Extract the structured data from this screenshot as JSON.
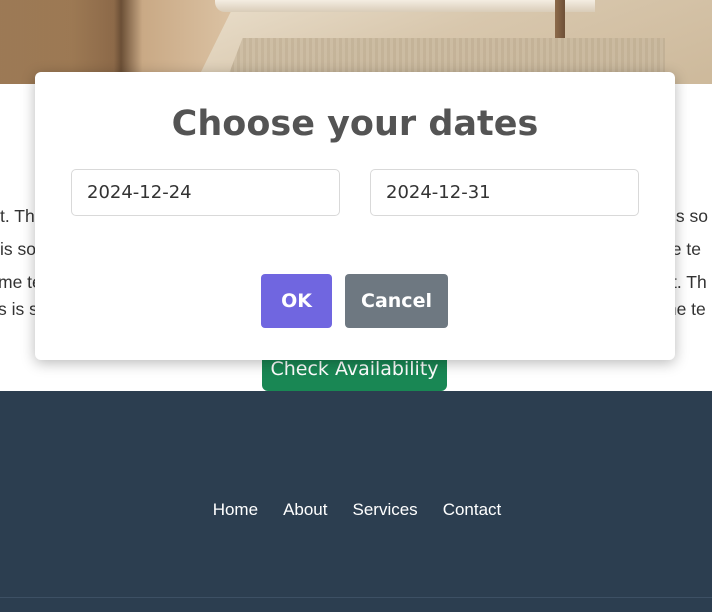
{
  "hero": {
    "image": "bedroom-photo"
  },
  "content": {
    "lines": [
      {
        "left": "t. Th",
        "right": "is so"
      },
      {
        "left": "is so",
        "right": "ne te"
      },
      {
        "left": "me te",
        "right": "t. Th"
      },
      {
        "left": "s is s",
        "right": "me te"
      }
    ],
    "check_availability_label": "Check Availability"
  },
  "modal": {
    "title": "Choose your dates",
    "start_date": "2024-12-24",
    "end_date": "2024-12-31",
    "ok_label": "OK",
    "cancel_label": "Cancel"
  },
  "footer": {
    "links": [
      "Home",
      "About",
      "Services",
      "Contact"
    ]
  },
  "colors": {
    "ok_button": "#7066e0",
    "cancel_button": "#6e7881",
    "check_button": "#198754",
    "footer_bg": "#2c3e50"
  }
}
